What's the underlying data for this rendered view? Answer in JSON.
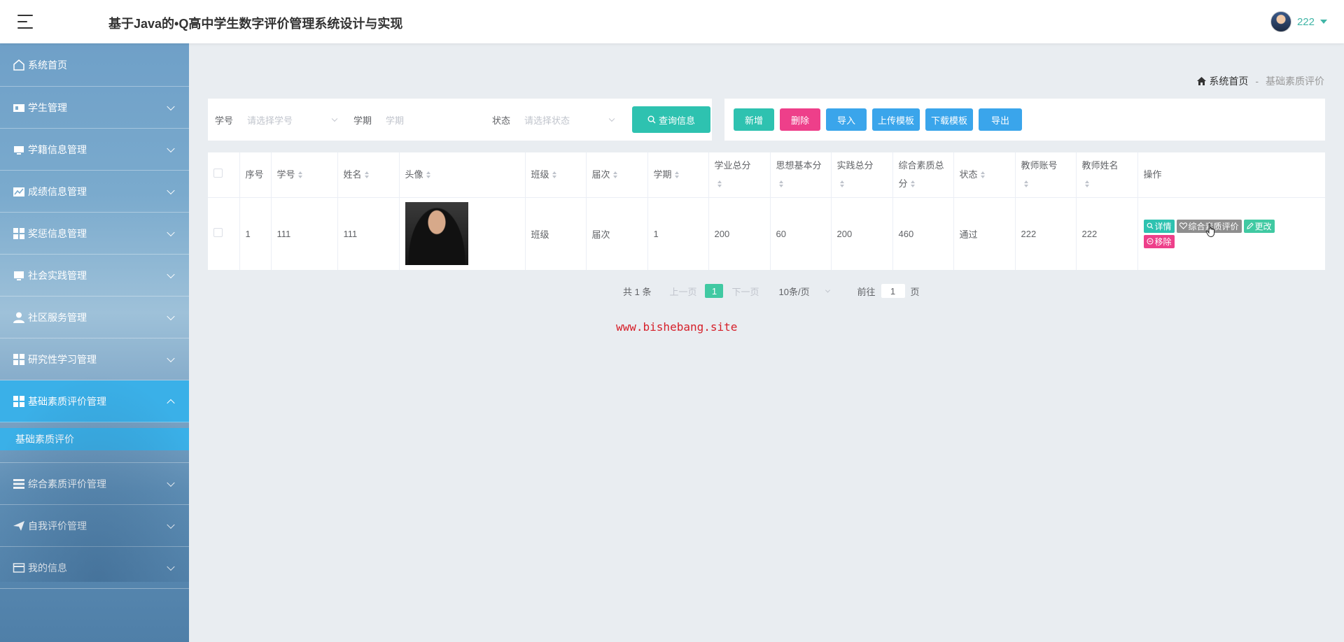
{
  "header": {
    "app_title": "基于Java的•Q高中学生数字评价管理系统设计与实现",
    "user_name": "222"
  },
  "sidebar": {
    "items": [
      {
        "label": "系统首页",
        "icon": "home-icon"
      },
      {
        "label": "学生管理",
        "icon": "id-card-icon"
      },
      {
        "label": "学籍信息管理",
        "icon": "monitor-icon"
      },
      {
        "label": "成绩信息管理",
        "icon": "chart-icon"
      },
      {
        "label": "奖惩信息管理",
        "icon": "grid-icon"
      },
      {
        "label": "社会实践管理",
        "icon": "monitor-icon"
      },
      {
        "label": "社区服务管理",
        "icon": "user-icon"
      },
      {
        "label": "研究性学习管理",
        "icon": "grid-icon"
      },
      {
        "label": "基础素质评价管理",
        "icon": "grid-icon"
      },
      {
        "label": "综合素质评价管理",
        "icon": "list-icon"
      },
      {
        "label": "自我评价管理",
        "icon": "send-icon"
      },
      {
        "label": "我的信息",
        "icon": "wallet-icon"
      }
    ],
    "active_sub": "基础素质评价"
  },
  "breadcrumb": {
    "home": "系统首页",
    "separator": "-",
    "current": "基础素质评价"
  },
  "search": {
    "xuehao_label": "学号",
    "xuehao_placeholder": "请选择学号",
    "xueqi_label": "学期",
    "xueqi_placeholder": "学期",
    "zhuangtai_label": "状态",
    "zhuangtai_placeholder": "请选择状态",
    "query_button": "查询信息"
  },
  "actions": {
    "add": "新增",
    "delete": "删除",
    "import": "导入",
    "upload_template": "上传模板",
    "download_template": "下载模板",
    "export": "导出"
  },
  "table": {
    "headers": {
      "index": "序号",
      "xuehao": "学号",
      "name": "姓名",
      "avatar": "头像",
      "banji": "班级",
      "jieci": "届次",
      "xueqi": "学期",
      "xueye_line1": "学业总分",
      "sixiang": "思想基本分",
      "shijian": "实践总分",
      "zonghe_line1": "综合素质总",
      "zonghe_line2": "分",
      "status": "状态",
      "teacher_no": "教师账号",
      "teacher_name": "教师姓名",
      "ops": "操作"
    },
    "rows": [
      {
        "index": "1",
        "xuehao": "111",
        "name": "111",
        "banji": "班级",
        "jieci": "届次",
        "xueqi": "1",
        "xueye": "200",
        "sixiang": "60",
        "shijian": "200",
        "zonghe": "460",
        "status": "通过",
        "teacher_no": "222",
        "teacher_name": "222"
      }
    ],
    "op_labels": {
      "detail": "详情",
      "evaluate": "综合素质评价",
      "edit": "更改",
      "remove": "移除"
    }
  },
  "pagination": {
    "total": "共 1 条",
    "prev": "上一页",
    "current_page": "1",
    "next": "下一页",
    "page_size": "10条/页",
    "goto_label": "前往",
    "goto_value": "1",
    "page_unit": "页"
  },
  "watermark": "www.bishebang.site",
  "colors": {
    "teal": "#2ec2b0",
    "pink": "#ee3f8a",
    "blue": "#3aa5eb",
    "gray": "#8e8e8e",
    "green": "#40c9a2",
    "sidebar_active": "#3ab0e8",
    "watermark": "#d6202a"
  }
}
